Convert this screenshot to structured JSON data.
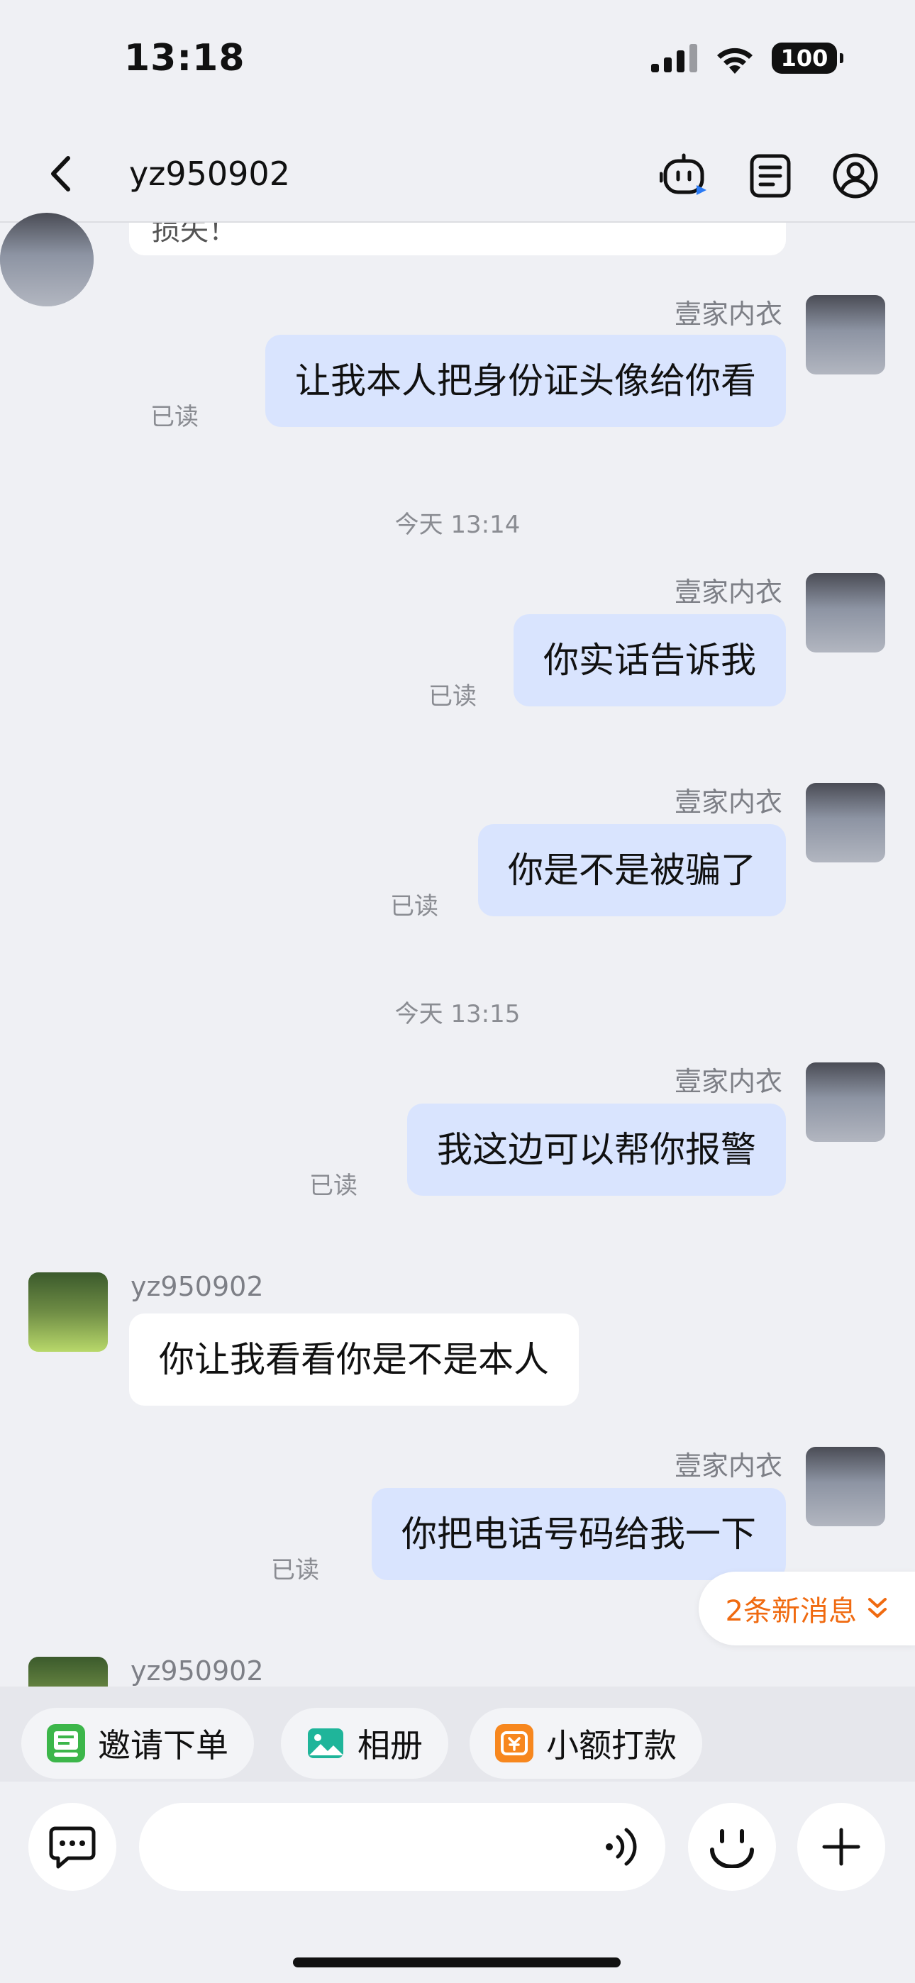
{
  "status_bar": {
    "time": "13:18",
    "battery": "100"
  },
  "nav": {
    "title": "yz950902"
  },
  "top_partial": {
    "text": "损失！"
  },
  "messages": [
    {
      "sender": "壹家内衣",
      "text": "让我本人把身份证头像给你看",
      "read": "已读"
    },
    {
      "sender": "壹家内衣",
      "text": "你实话告诉我",
      "read": "已读"
    },
    {
      "sender": "壹家内衣",
      "text": "你是不是被骗了",
      "read": "已读"
    },
    {
      "sender": "壹家内衣",
      "text": "我这边可以帮你报警",
      "read": "已读"
    },
    {
      "sender": "yz950902",
      "text": "你让我看看你是不是本人"
    },
    {
      "sender": "壹家内衣",
      "text": "你把电话号码给我一下",
      "read": "已读"
    },
    {
      "sender": "yz950902"
    }
  ],
  "time_separators": [
    "今天 13:14",
    "今天 13:15"
  ],
  "new_messages": {
    "label": "2条新消息"
  },
  "quick_actions": [
    {
      "label": "邀请下单",
      "icon": "order-icon"
    },
    {
      "label": "相册",
      "icon": "album-icon"
    },
    {
      "label": "小额打款",
      "icon": "payment-icon"
    }
  ],
  "input": {
    "value": "",
    "placeholder": ""
  },
  "colors": {
    "outgoing_bubble": "#d9e4fe",
    "incoming_bubble": "#ffffff",
    "accent_orange": "#f06a10",
    "background": "#eff0f4"
  }
}
